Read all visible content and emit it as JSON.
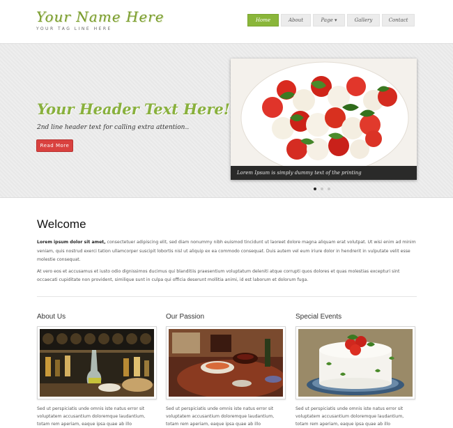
{
  "logo": {
    "name": "Your Name Here",
    "tagline": "YOUR TAG LINE HERE"
  },
  "nav": [
    {
      "label": "Home",
      "active": true
    },
    {
      "label": "About"
    },
    {
      "label": "Page ▾"
    },
    {
      "label": "Gallery"
    },
    {
      "label": "Contact"
    }
  ],
  "hero": {
    "title": "Your Header Text Here!",
    "subtitle": "2nd line header text for calling extra attention..",
    "button": "Read More",
    "slide_caption": "Lorem Ipsum is simply dummy text of the printing"
  },
  "welcome": {
    "title": "Welcome",
    "lead": "Lorem ipsum dolor sit amet,",
    "p1": " consectetuer adipiscing elit, sed diam nonummy nibh euismod tincidunt ut laoreet dolore magna aliquam erat volutpat. Ut wisi enim ad minim veniam, quis nostrud exerci tation ullamcorper suscipit lobortis nisl ut aliquip ex ea commodo consequat. Duis autem vel eum iriure dolor in hendrerit in vulputate velit esse molestie consequat.",
    "p2": "At vero eos et accusamus et iusto odio dignissimos ducimus qui blanditiis praesentium voluptatum deleniti atque corrupti quos dolores et quas molestias excepturi sint occaecati cupiditate non provident, similique sunt in culpa qui officia deserunt mollitia animi, id est laborum et dolorum fuga."
  },
  "columns": [
    {
      "title": "About Us",
      "text": "Sed ut perspiciatis unde omnis iste natus error sit voluptatem accusantium doloremque laudantium, totam rem aperiam, eaque ipsa quae ab illo"
    },
    {
      "title": "Our Passion",
      "text": "Sed ut perspiciatis unde omnis iste natus error sit voluptatem accusantium doloremque laudantium, totam rem aperiam, eaque ipsa quae ab illo"
    },
    {
      "title": "Special Events",
      "text": "Sed ut perspiciatis unde omnis iste natus error sit voluptatem accusantium doloremque laudantium, totam rem aperiam, eaque ipsa quae ab illo"
    }
  ],
  "colors": {
    "accent_green": "#8ab63a",
    "button_red": "#d9413f"
  }
}
